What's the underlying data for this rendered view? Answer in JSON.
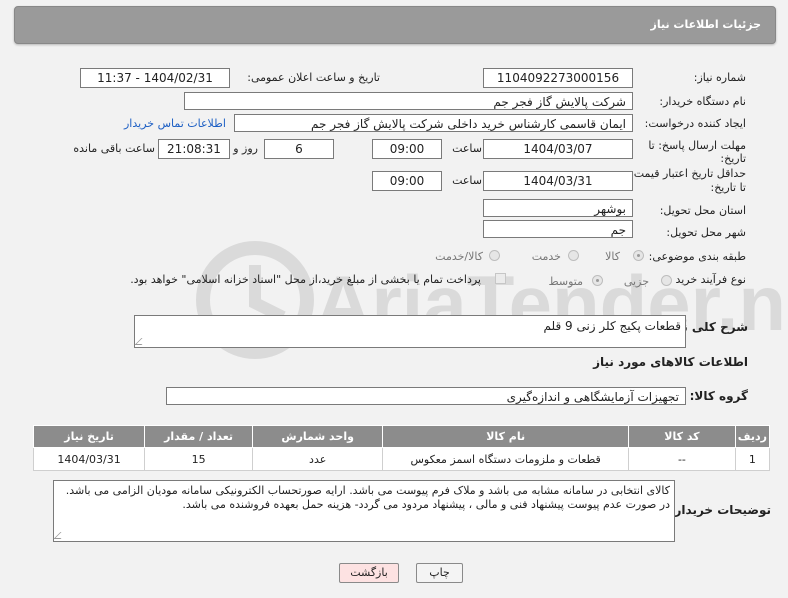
{
  "header": {
    "title": "جزئیات اطلاعات نیاز"
  },
  "form": {
    "need_number_label": "شماره نیاز:",
    "need_number": "1104092273000156",
    "announce_label": "تاریخ و ساعت اعلان عمومی:",
    "announce_value": "1404/02/31 - 11:37",
    "buyer_label": "نام دستگاه خریدار:",
    "buyer_value": "شرکت پالایش گاز فجر جم",
    "creator_label": "ایجاد کننده درخواست:",
    "creator_value": "ایمان قاسمی کارشناس خرید داخلی شرکت پالایش گاز فجر جم",
    "contact_link": "اطلاعات تماس خریدار",
    "deadline_label_1": "مهلت ارسال پاسخ: تا",
    "deadline_label_2": "تاریخ:",
    "deadline_date": "1404/03/07",
    "time_label": "ساعت",
    "deadline_time": "09:00",
    "days_value": "6",
    "days_label": "روز و",
    "remaining_time": "21:08:31",
    "remaining_label": "ساعت باقی مانده",
    "validity_label_1": "حداقل تاریخ اعتبار قیمت:",
    "validity_label_2": "تا تاریخ:",
    "validity_date": "1404/03/31",
    "validity_time": "09:00",
    "province_label": "استان محل تحویل:",
    "province_value": "بوشهر",
    "city_label": "شهر محل تحویل:",
    "city_value": "جم",
    "category_label": "طبقه بندی موضوعی:",
    "category_options": [
      "کالا",
      "خدمت",
      "کالا/خدمت"
    ],
    "process_label": "نوع فرآیند خرید :",
    "process_options": [
      "جزیی",
      "متوسط"
    ],
    "payment_note": "پرداخت تمام یا بخشی از مبلغ خرید،از محل \"اسناد خزانه اسلامی\" خواهد بود."
  },
  "description": {
    "label": "شرح کلی نیاز:",
    "value": "قطعات پکیج کلر زنی 9 قلم"
  },
  "goods_section": {
    "title": "اطلاعات کالاهای مورد نیاز",
    "group_label": "گروه کالا:",
    "group_value": "تجهیزات آزمایشگاهی و اندازه‌گیری",
    "columns": [
      "ردیف",
      "کد کالا",
      "نام کالا",
      "واحد شمارش",
      "تعداد / مقدار",
      "تاریخ نیاز"
    ],
    "rows": [
      {
        "row": "1",
        "code": "--",
        "name": "قطعات و ملزومات دستگاه اسمز معکوس",
        "unit": "عدد",
        "qty": "15",
        "date": "1404/03/31"
      }
    ]
  },
  "buyer_notes": {
    "label": "توضیحات خریدار:",
    "value": "کالای انتخابی در سامانه مشابه می باشد و ملاک فرم پیوست می باشد.  ارایه صورتحساب الکترونیکی سامانه مودیان الزامی می باشد. در صورت عدم پیوست پیشنهاد فنی و مالی ، پیشنهاد مردود می گردد- هزینه حمل بعهده فروشنده می باشد."
  },
  "buttons": {
    "print": "چاپ",
    "back": "بازگشت"
  },
  "watermark": {
    "text": "AriaTender.neT"
  },
  "colors": {
    "header_bg": "#9a9a9a",
    "table_header_bg": "#8c8c8c",
    "link": "#1d5fc4",
    "back_button_bg": "#fde2e2"
  }
}
